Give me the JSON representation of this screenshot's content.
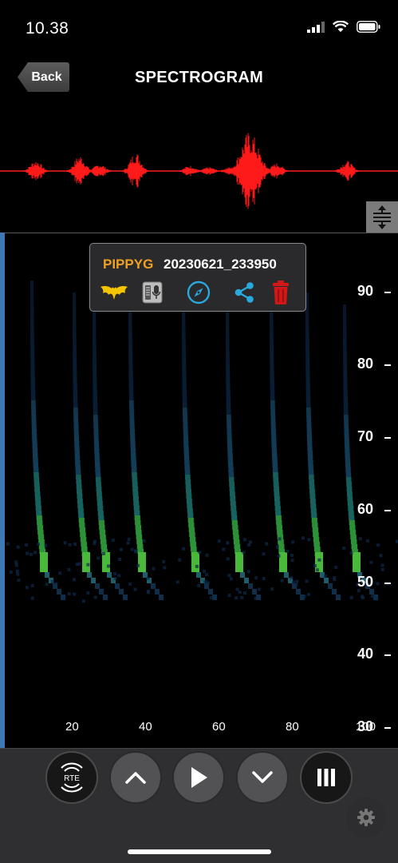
{
  "status": {
    "time": "10.38"
  },
  "nav": {
    "back_label": "Back",
    "title": "SPECTROGRAM"
  },
  "popup": {
    "species_code": "PIPPYG",
    "recording_name": "20230621_233950",
    "icons": [
      "bat-icon",
      "recorder-icon",
      "compass-icon",
      "share-icon",
      "trash-icon"
    ]
  },
  "y_axis": {
    "labels": [
      "90",
      "80",
      "70",
      "60",
      "50",
      "40",
      "30"
    ]
  },
  "x_axis": {
    "labels": [
      "20",
      "40",
      "60",
      "80",
      "100"
    ]
  },
  "controls": {
    "rte_label": "RTE",
    "buttons": [
      "rte-button",
      "scroll-up-button",
      "play-button",
      "scroll-down-button",
      "pause-button"
    ]
  },
  "colors": {
    "waveform": "#ff1a1a",
    "species": "#f0a020",
    "accent_blue": "#2aa9e0",
    "trash": "#d01818",
    "bat": "#f5c400"
  }
}
